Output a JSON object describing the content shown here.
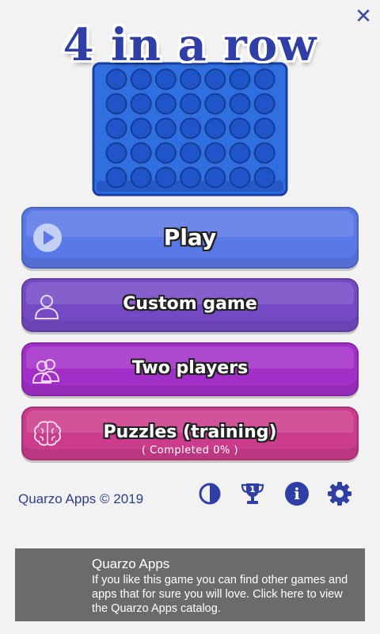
{
  "header": {
    "close_symbol": "✕",
    "title": "4 in a row"
  },
  "menu": {
    "play": {
      "label": "Play",
      "icon": "play-icon",
      "color": "#5b78e8"
    },
    "custom_game": {
      "label": "Custom game",
      "icon": "person-icon",
      "color": "#7549c4"
    },
    "two_players": {
      "label": "Two players",
      "icon": "two-persons-icon",
      "color": "#a32fc9"
    },
    "puzzles": {
      "label": "Puzzles (training)",
      "sublabel": "( Completed 0% )",
      "icon": "brain-icon",
      "color": "#cc3c8c"
    }
  },
  "footer": {
    "copyright": "Quarzo Apps  © 2019",
    "icons": [
      "contrast-icon",
      "trophy-icon",
      "info-icon",
      "settings-gear-icon"
    ],
    "trophy_number": "1",
    "info_symbol": "i"
  },
  "banner": {
    "title": "Quarzo Apps",
    "text": "If you like this game you can find other games and apps that for sure you will love. Click here to view the Quarzo Apps catalog."
  },
  "colors": {
    "accent": "#2f3fa6",
    "board": "#2f6fe0",
    "background": "#f2f2f2",
    "banner": "#6b6b6b"
  }
}
